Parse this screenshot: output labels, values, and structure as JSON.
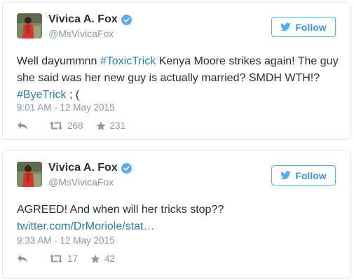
{
  "tweets": [
    {
      "name": "Vivica A. Fox",
      "handle": "@MsVivicaFox",
      "follow_label": "Follow",
      "text_parts": {
        "p1": "Well dayummnn ",
        "tag1": "#ToxicTrick",
        "p2": " Kenya Moore strikes again! The guy she said was her new guy is actually married? SMDH WTH!? ",
        "tag2": "#ByeTrick",
        "p3": " ; ("
      },
      "timestamp": "9:01 AM - 12 May 2015",
      "retweets": "268",
      "favorites": "231"
    },
    {
      "name": "Vivica A. Fox",
      "handle": "@MsVivicaFox",
      "follow_label": "Follow",
      "text_parts": {
        "p1": "AGREED!  And when will her tricks stop??",
        "link": "twitter.com/DrMoriole/stat…"
      },
      "timestamp": "9:33 AM - 12 May 2015",
      "retweets": "17",
      "favorites": "42"
    }
  ],
  "icons": {
    "verified": "verified-badge-icon",
    "bird": "twitter-bird-icon",
    "reply": "reply-icon",
    "retweet": "retweet-icon",
    "favorite": "star-icon"
  },
  "colors": {
    "accent": "#55acee",
    "link": "#2b7bb9",
    "muted": "#8899a6",
    "text": "#292f33",
    "border": "#e1e8ed"
  }
}
